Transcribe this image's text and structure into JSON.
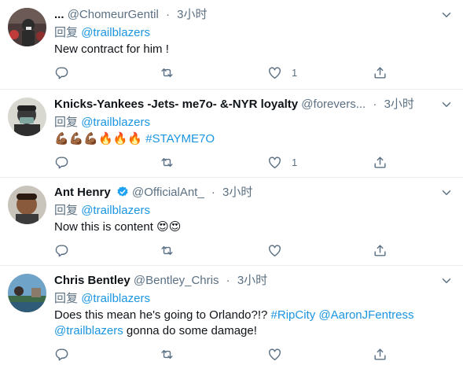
{
  "tweets": [
    {
      "name": "...",
      "handle": "@ChomeurGentil",
      "dot": "·",
      "time": "3小时",
      "reply_prefix": "回复",
      "reply_to": "@trailblazers",
      "text": "New contract for him !",
      "likes": "1"
    },
    {
      "name": "Knicks-Yankees -Jets- me7o- &-NYR loyalty",
      "handle": "@forevers...",
      "dot": "·",
      "time": "3小时",
      "reply_prefix": "回复",
      "reply_to": "@trailblazers",
      "emojis": "💪🏾💪🏾💪🏾🔥🔥🔥",
      "hashtag": "#STAYME7O",
      "likes": "1"
    },
    {
      "name": "Ant Henry",
      "handle": "@OfficialAnt_",
      "dot": "·",
      "time": "3小时",
      "reply_prefix": "回复",
      "reply_to": "@trailblazers",
      "text": "Now this is content",
      "emojis": "😍😍",
      "verified": true
    },
    {
      "name": "Chris Bentley",
      "handle": "@Bentley_Chris",
      "dot": "·",
      "time": "3小时",
      "reply_prefix": "回复",
      "reply_to": "@trailblazers",
      "line1": "Does this mean he's going to Orlando?!? ",
      "hashtag": "#RipCity",
      "mention1": "@AaronJFentress",
      "mention2": "@trailblazers",
      "line2_rest": " gonna do some damage!"
    }
  ],
  "colors": {
    "link": "#1b95e0",
    "secondary": "#5b7083",
    "text": "#0f1419",
    "border": "#e6ecf0"
  }
}
